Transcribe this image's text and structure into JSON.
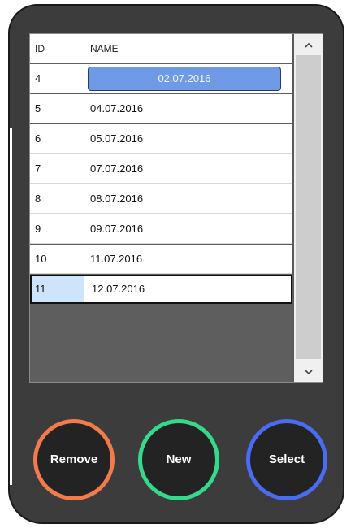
{
  "grid": {
    "columns": [
      "ID",
      "NAME"
    ],
    "rows": [
      {
        "id": "4",
        "name": "02.07.2016"
      },
      {
        "id": "5",
        "name": "04.07.2016"
      },
      {
        "id": "6",
        "name": "05.07.2016"
      },
      {
        "id": "7",
        "name": "07.07.2016"
      },
      {
        "id": "8",
        "name": "08.07.2016"
      },
      {
        "id": "9",
        "name": "09.07.2016"
      },
      {
        "id": "10",
        "name": "11.07.2016"
      },
      {
        "id": "11",
        "name": "12.07.2016"
      }
    ],
    "selected_row_index": 0,
    "current_row_index": 7
  },
  "scrollbar": {
    "up_icon": "chevron-up-icon",
    "down_icon": "chevron-down-icon"
  },
  "buttons": {
    "remove": "Remove",
    "new": "New",
    "select": "Select"
  },
  "colors": {
    "remove_ring": "#f37a4c",
    "new_ring": "#35d98c",
    "select_ring": "#4a6cf2",
    "selection": "#6e9ae6",
    "current_id_cell": "#cde4fb",
    "window_bg": "#3c3c3c"
  }
}
